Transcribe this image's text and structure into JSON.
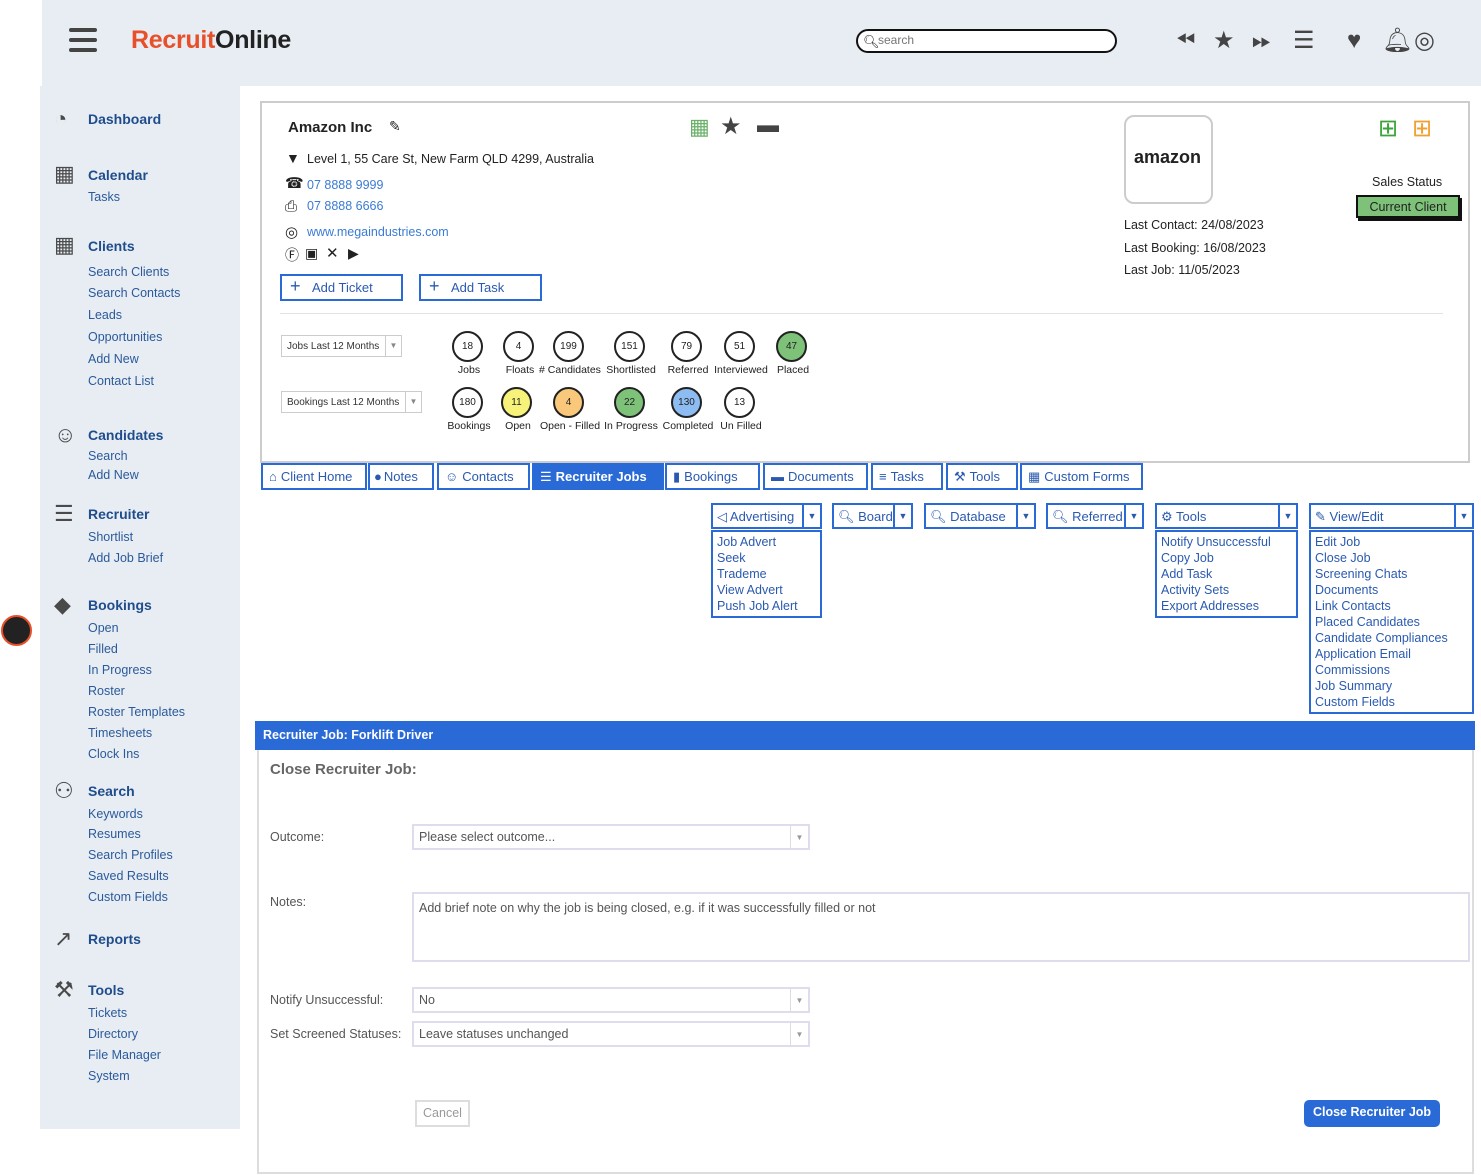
{
  "header": {
    "logo_prefix": "Recruit",
    "logo_o": "O",
    "logo_suffix": "nline",
    "search_placeholder": "search",
    "icons": [
      "rewind-icon",
      "star-icon",
      "forward-icon",
      "list-icon",
      "heart-icon",
      "bell-icon",
      "user-icon"
    ]
  },
  "sidebar": {
    "dashboard": "Dashboard",
    "calendar": "Calendar",
    "calendar_tasks": "Tasks",
    "clients": "Clients",
    "clients_items": [
      "Search Clients",
      "Search Contacts",
      "Leads",
      "Opportunities",
      "Add New",
      "Contact List"
    ],
    "candidates": "Candidates",
    "candidates_items": [
      "Search",
      "Add New"
    ],
    "recruiter": "Recruiter",
    "recruiter_items": [
      "Shortlist",
      "Add Job Brief"
    ],
    "bookings": "Bookings",
    "bookings_items": [
      "Open",
      "Filled",
      "In Progress",
      "Roster",
      "Roster Templates",
      "Timesheets",
      "Clock Ins"
    ],
    "search": "Search",
    "search_items": [
      "Keywords",
      "Resumes",
      "Search Profiles",
      "Saved Results",
      "Custom Fields"
    ],
    "reports": "Reports",
    "tools": "Tools",
    "tools_items": [
      "Tickets",
      "Directory",
      "File Manager",
      "System"
    ]
  },
  "client": {
    "name": "Amazon Inc",
    "address": "Level 1, 55 Care St, New Farm QLD 4299, Australia",
    "phone": "07 8888 9999",
    "fax": "07 8888 6666",
    "website": "www.megaindustries.com",
    "add_ticket": "Add Ticket",
    "add_task": "Add Task",
    "logo_text": "amazon",
    "last_contact": "Last Contact: 24/08/2023",
    "last_booking": "Last Booking: 16/08/2023",
    "last_job": "Last Job: 11/05/2023",
    "sales_status_label": "Sales Status",
    "sales_status": "Current Client",
    "accent_color": "#2a6ad6"
  },
  "stats": {
    "jobs_filter": "Jobs Last 12 Months",
    "bookings_filter": "Bookings Last 12 Months",
    "jobs": [
      {
        "value": "18",
        "label": "Jobs",
        "color": "#ffffff"
      },
      {
        "value": "4",
        "label": "Floats",
        "color": "#ffffff"
      },
      {
        "value": "199",
        "label": "# Candidates",
        "color": "#ffffff"
      },
      {
        "value": "151",
        "label": "Shortlisted",
        "color": "#ffffff"
      },
      {
        "value": "79",
        "label": "Referred",
        "color": "#ffffff"
      },
      {
        "value": "51",
        "label": "Interviewed",
        "color": "#ffffff"
      },
      {
        "value": "47",
        "label": "Placed",
        "color": "#7ec27a"
      }
    ],
    "bookings": [
      {
        "value": "180",
        "label": "Bookings",
        "color": "#ffffff"
      },
      {
        "value": "11",
        "label": "Open",
        "color": "#f7f37a"
      },
      {
        "value": "4",
        "label": "Open - Filled",
        "color": "#f9c87a"
      },
      {
        "value": "22",
        "label": "In Progress",
        "color": "#7ec27a"
      },
      {
        "value": "130",
        "label": "Completed",
        "color": "#8dbcf2"
      },
      {
        "value": "13",
        "label": "Un Filled",
        "color": "#ffffff"
      }
    ]
  },
  "tabs": [
    "Client Home",
    "Notes",
    "Contacts",
    "Recruiter Jobs",
    "Bookings",
    "Documents",
    "Tasks",
    "Tools",
    "Custom Forms"
  ],
  "dropdowns": {
    "advertising": "Advertising",
    "advertising_items": [
      "Job Advert",
      "Seek",
      "Trademe",
      "View Advert",
      "Push Job Alert"
    ],
    "board": "Board",
    "database": "Database",
    "referred": "Referred",
    "tools": "Tools",
    "tools_items": [
      "Notify Unsuccessful",
      "Copy Job",
      "Add Task",
      "Activity Sets",
      "Export Addresses"
    ],
    "view_edit": "View/Edit",
    "view_edit_items": [
      "Edit Job",
      "Close Job",
      "Screening Chats",
      "Documents",
      "Link Contacts",
      "Placed Candidates",
      "Candidate Compliances",
      "Application Email",
      "Commissions",
      "Job Summary",
      "Custom Fields"
    ]
  },
  "panel": {
    "header": "Recruiter Job: Forklift Driver",
    "title": "Close Recruiter Job:",
    "outcome_label": "Outcome:",
    "outcome_value": "Please select outcome...",
    "notes_label": "Notes:",
    "notes_placeholder": "Add brief note on why the job is being closed, e.g. if it was successfully filled or not",
    "notify_label": "Notify Unsuccessful:",
    "notify_value": "No",
    "screened_label": "Set Screened Statuses:",
    "screened_value": "Leave statuses unchanged",
    "cancel": "Cancel",
    "submit": "Close Recruiter Job"
  }
}
